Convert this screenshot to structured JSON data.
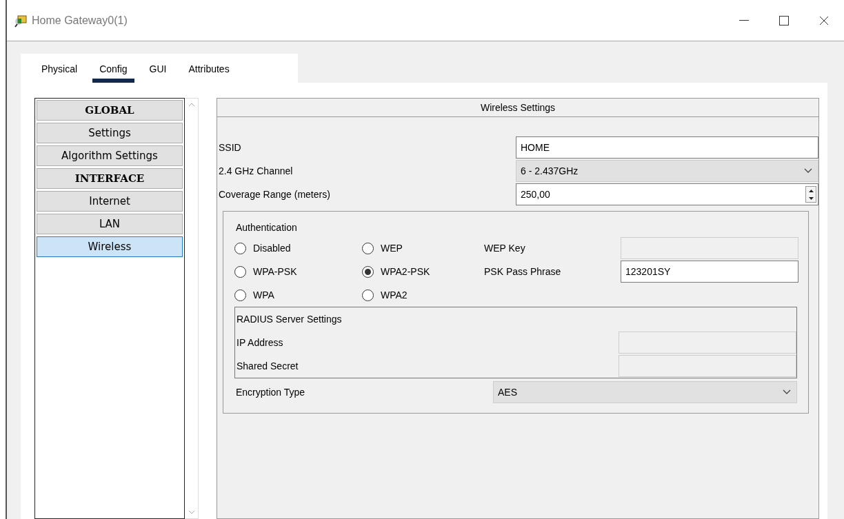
{
  "window": {
    "title": "Home Gateway0(1)"
  },
  "tabs": [
    {
      "label": "Physical",
      "selected": false
    },
    {
      "label": "Config",
      "selected": true
    },
    {
      "label": "GUI",
      "selected": false
    },
    {
      "label": "Attributes",
      "selected": false
    }
  ],
  "sidebar": {
    "items": [
      {
        "label": "GLOBAL",
        "kind": "header",
        "selected": false
      },
      {
        "label": "Settings",
        "kind": "item",
        "selected": false
      },
      {
        "label": "Algorithm Settings",
        "kind": "item",
        "selected": false
      },
      {
        "label": "INTERFACE",
        "kind": "header",
        "selected": false
      },
      {
        "label": "Internet",
        "kind": "item",
        "selected": false
      },
      {
        "label": "LAN",
        "kind": "item",
        "selected": false
      },
      {
        "label": "Wireless",
        "kind": "item",
        "selected": true
      }
    ]
  },
  "panel": {
    "title": "Wireless Settings",
    "fields": [
      {
        "label": "SSID",
        "kind": "text",
        "value": "HOME"
      },
      {
        "label": "2.4 GHz Channel",
        "kind": "select",
        "value": "6 - 2.437GHz"
      },
      {
        "label": "Coverage Range (meters)",
        "kind": "spin",
        "value": "250,00"
      }
    ],
    "authentication": {
      "title": "Authentication",
      "options": [
        {
          "label": "Disabled",
          "selected": false
        },
        {
          "label": "WEP",
          "selected": false
        },
        {
          "label": "WPA-PSK",
          "selected": false
        },
        {
          "label": "WPA2-PSK",
          "selected": true
        },
        {
          "label": "WPA",
          "selected": false
        },
        {
          "label": "WPA2",
          "selected": false
        }
      ],
      "keys": [
        {
          "label": "WEP Key",
          "disabled": true
        },
        {
          "label": "PSK Pass Phrase",
          "disabled": false,
          "value": "123201SY"
        }
      ],
      "radius": {
        "title": "RADIUS Server Settings",
        "fields": [
          {
            "label": "IP Address",
            "disabled": true
          },
          {
            "label": "Shared Secret",
            "disabled": true
          }
        ]
      },
      "encryption": {
        "label": "Encryption Type",
        "value": "AES"
      }
    }
  }
}
